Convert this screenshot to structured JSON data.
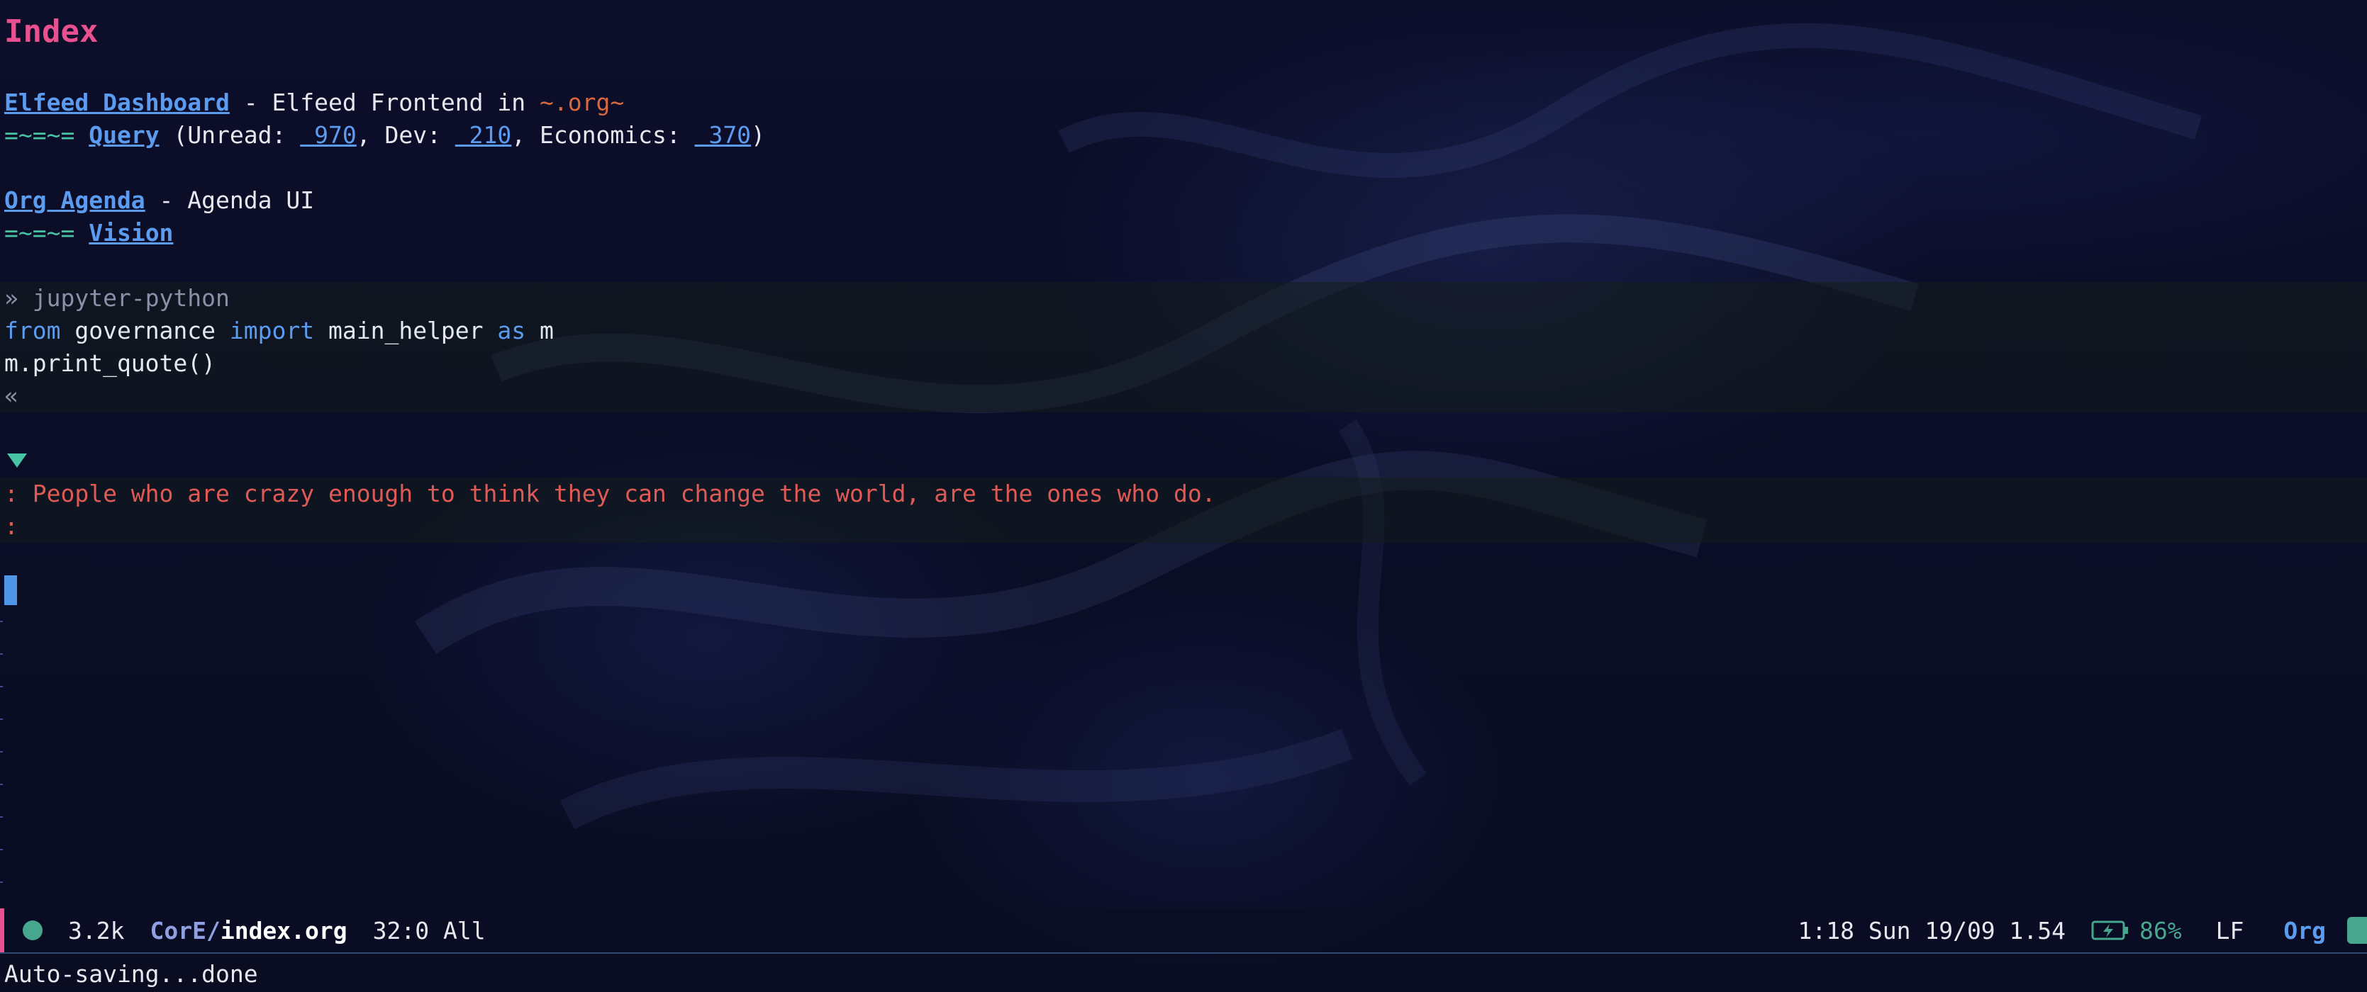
{
  "buffer": {
    "title": "Index",
    "elfeed": {
      "link": "Elfeed Dashboard",
      "dash": " - Elfeed Frontend in ",
      "verbatim": "~.org~",
      "bullet": "=~=~=",
      "query_link": "Query",
      "unread_label": "(Unread: ",
      "unread_count": " 970",
      "dev_label": ", Dev: ",
      "dev_count": " 210",
      "economics_label": ", Economics: ",
      "economics_count": " 370",
      "close_paren": ")"
    },
    "agenda": {
      "link": "Org Agenda",
      "dash": " - Agenda UI",
      "bullet": "=~=~=",
      "vision_link": "Vision"
    },
    "src_block": {
      "begin": "» jupyter-python",
      "line1_from": "from",
      "line1_module": " governance ",
      "line1_import": "import",
      "line1_name": " main_helper ",
      "line1_as": "as",
      "line1_alias": " m",
      "line2": "m.print_quote()",
      "end": "«"
    },
    "results": {
      "line1": ": People who are crazy enough to think they can change the world, are the ones who do.",
      "line2": ":"
    }
  },
  "modeline": {
    "size": "3.2k",
    "dir": "CorE/",
    "file": "index.org",
    "position": "32:0 All",
    "time": "1:18 Sun 19/09 1.54",
    "battery": "86%",
    "eol": "LF",
    "mode": "Org"
  },
  "echo_area": {
    "message": "Auto-saving...done"
  },
  "colors": {
    "background": "#0b0d24",
    "title": "#e8508f",
    "link": "#5b9cf0",
    "accent_green": "#46a68e",
    "result_red": "#e05a55",
    "verbatim_orange": "#d9683e"
  }
}
